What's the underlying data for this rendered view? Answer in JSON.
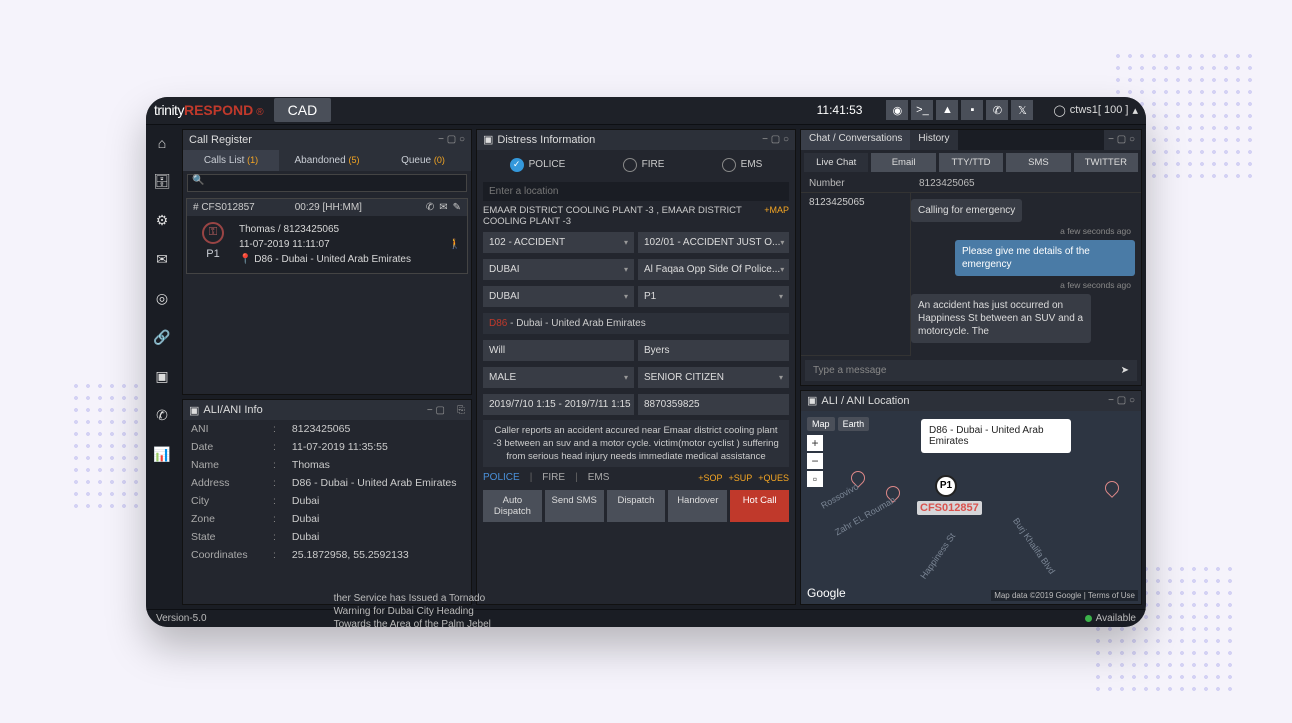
{
  "header": {
    "logo1": "trinity",
    "logo2": "RESPOND",
    "reg": "®",
    "tab": "CAD",
    "clock": "11:41:53",
    "user": "ctws1[ 100 ]"
  },
  "callreg": {
    "title": "Call Register",
    "tabs": {
      "list": "Calls List",
      "listN": "(1)",
      "ab": "Abandoned",
      "abN": "(5)",
      "q": "Queue",
      "qN": "(0)"
    },
    "card": {
      "id": "# CFS012857",
      "time": "00:29 [HH:MM]",
      "name": "Thomas / 8123425065",
      "dt": "11-07-2019 11:11:07",
      "loc": "D86 - Dubai - United Arab Emirates",
      "p": "P1"
    }
  },
  "ali": {
    "title": "ALI/ANI Info",
    "rows": {
      "ani_l": "ANI",
      "ani": "8123425065",
      "date_l": "Date",
      "date": "11-07-2019 11:35:55",
      "name_l": "Name",
      "name": "Thomas",
      "addr_l": "Address",
      "addr": "D86 - Dubai - United Arab Emirates",
      "city_l": "City",
      "city": "Dubai",
      "zone_l": "Zone",
      "zone": "Dubai",
      "state_l": "State",
      "state": "Dubai",
      "coord_l": "Coordinates",
      "coord": "25.1872958, 55.2592133"
    }
  },
  "distress": {
    "title": "Distress Information",
    "svc": {
      "police": "POLICE",
      "fire": "FIRE",
      "ems": "EMS"
    },
    "loc_ph": "Enter a location",
    "desc": "EMAAR DISTRICT COOLING PLANT -3 , EMAAR DISTRICT COOLING PLANT -3",
    "map": "+MAP",
    "sel": {
      "type": "102 - ACCIDENT",
      "sub": "102/01 - ACCIDENT JUST O...",
      "em": "DUBAI",
      "near": "Al Faqaa Opp Side Of Police...",
      "em2": "DUBAI",
      "pri": "P1",
      "dt": "2019/7/10 1:15 - 2019/7/11 1:15",
      "ph": "8870359825",
      "fn": "Will",
      "ln": "Byers",
      "gen": "MALE",
      "cat": "SENIOR CITIZEN"
    },
    "addr_d": "D86",
    "addr_r": " - Dubai - United Arab Emirates",
    "notes": "Caller reports an accident accured near Emaar district cooling plant -3 between an suv and a motor cycle. victim(motor cyclist ) suffering from serious head injury needs immediate medical assistance",
    "labels": {
      "police": "POLICE",
      "fire": "FIRE",
      "ems": "EMS",
      "sop": "+SOP",
      "sup": "+SUP",
      "ques": "+QUES"
    },
    "btns": {
      "auto": "Auto Dispatch",
      "sms": "Send SMS",
      "disp": "Dispatch",
      "hand": "Handover",
      "hot": "Hot Call"
    }
  },
  "chat": {
    "title": "Chat / Conversations",
    "htab": "History",
    "subtabs": {
      "live": "Live Chat",
      "email": "Email",
      "tty": "TTY/TTD",
      "sms": "SMS",
      "tw": "TWITTER"
    },
    "numh": "Number",
    "numv": "8123425065",
    "left": "8123425065",
    "m1": "Calling for emergency",
    "t1": "a few seconds ago",
    "m2": "Please give me details of the emergency",
    "t2": "a few seconds ago",
    "m3": "An accident has just occurred on Happiness St between an SUV and a motorcycle. The",
    "ph": "Type a message"
  },
  "map": {
    "title": "ALI / ANI Location",
    "tabs": {
      "map": "Map",
      "earth": "Earth"
    },
    "balloon": "D86 - Dubai - United Arab Emirates",
    "pin": "P1",
    "cfs": "CFS012857",
    "roads": {
      "r1": "Zahr EL Rouman",
      "r2": "Happiness St",
      "r3": "Burj Khalifa Blvd",
      "r4": "Rossovivo"
    },
    "logo": "Google",
    "attr1": "Map data ©2019 Google",
    "attr2": "Terms of Use"
  },
  "footer": {
    "ver": "Version-5.0",
    "ticker": "ther Service has Issued a Tornado Warning for Dubai City Heading Towards the Area of the Palm Jebel Ali",
    "avail": "Available"
  }
}
